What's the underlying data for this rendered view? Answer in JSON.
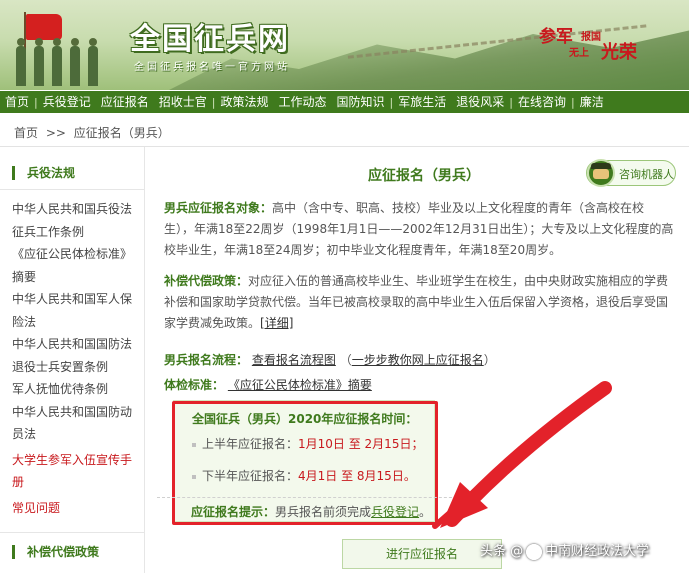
{
  "banner": {
    "site_title": "全国征兵网",
    "site_subtitle": "全国征兵报名唯一官方网站",
    "slogan": {
      "part1": "参军",
      "part2": "报国",
      "part3": "无上",
      "part4": "光荣"
    }
  },
  "nav": {
    "items": [
      "首页",
      "兵役登记",
      "应征报名",
      "招收士官",
      "政策法规",
      "工作动态",
      "国防知识",
      "军旅生活",
      "退役风采",
      "在线咨询",
      "廉洁"
    ]
  },
  "breadcrumb": {
    "home": "首页",
    "sep": ">>",
    "current": "应征报名（男兵）"
  },
  "sidebar": {
    "section1_title": "兵役法规",
    "links": [
      "中华人民共和国兵役法",
      "征兵工作条例",
      "《应征公民体检标准》",
      "摘要",
      "中华人民共和国军人保",
      "险法",
      "中华人民共和国国防法",
      "退役士兵安置条例",
      "军人抚恤优待条例",
      "中华人民共和国国防动",
      "员法",
      "大学生参军入伍宣传手",
      "册",
      "常见问题"
    ],
    "section2_title": "补偿代偿政策"
  },
  "main": {
    "title": "应征报名（男兵）",
    "robot_label": "咨询机器人",
    "target_label": "男兵应征报名对象：",
    "target_text": "高中（含中专、职高、技校）毕业及以上文化程度的青年（含高校在校生），年满18至22周岁（1998年1月1日——2002年12月31日出生）；大专及以上文化程度的高校毕业生，年满18至24周岁；初中毕业文化程度青年，年满18至20周岁。",
    "comp_label": "补偿代偿政策：",
    "comp_text": "对应征入伍的普通高校毕业生、毕业班学生在校生，由中央财政实施相应的学费补偿和国家助学贷款代偿。当年已被高校录取的高中毕业生入伍后保留入学资格，退役后享受国家学费减免政策。",
    "comp_link": "[详细]",
    "flow_label": "男兵报名流程：",
    "flow_link1": "查看报名流程图",
    "flow_link2": "一步步教你网上应征报名",
    "flow_paren_open": "（",
    "flow_paren_close": "）",
    "exam_label": "体检标准：",
    "exam_link": "《应征公民体检标准》摘要",
    "notice_title": "全国征兵（男兵）2020年应征报名时间：",
    "first_half_label": "上半年应征报名：",
    "first_half_value": "1月10日 至 2月15日；",
    "second_half_label": "下半年应征报名：",
    "second_half_value": "4月1日 至 8月15日。",
    "tip_label": "应征报名提示：",
    "tip_text": "男兵报名前须完成",
    "tip_link": "兵役登记",
    "tip_end": "。",
    "apply_button": "进行应征报名"
  },
  "watermark": {
    "prefix": "头条 @",
    "name": "中南财经政法大学"
  },
  "colors": {
    "brand_green": "#3f7a1d",
    "annotation_red": "#e3222a",
    "highlight_red": "#c8191d"
  }
}
